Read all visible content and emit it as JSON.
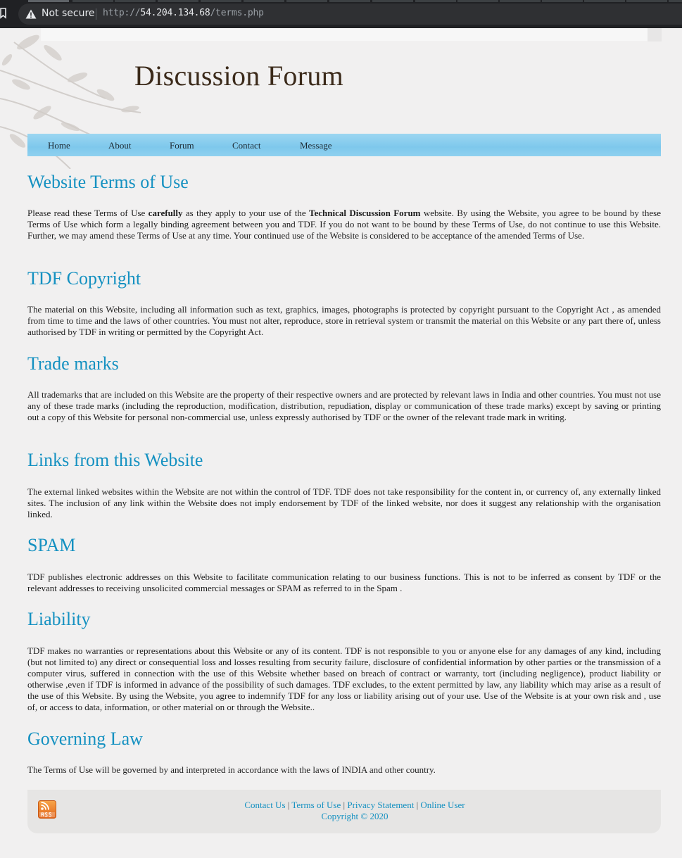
{
  "browser": {
    "security_label": "Not secure",
    "url_scheme": "http://",
    "url_host": "54.204.134.68",
    "url_path": "/terms.php"
  },
  "site": {
    "title": "Discussion Forum"
  },
  "nav": {
    "items": [
      {
        "label": "Home"
      },
      {
        "label": "About"
      },
      {
        "label": "Forum"
      },
      {
        "label": "Contact"
      },
      {
        "label": "Message"
      }
    ]
  },
  "sections": [
    {
      "heading": "Website Terms of Use",
      "body_parts": [
        "Please read these Terms of Use ",
        "carefully",
        " as they apply to your use of the ",
        "Technical Discussion Forum",
        " website. By using the Website, you agree to be bound by these Terms of Use which form a legally binding agreement between you and TDF. If you do not want to be bound by these Terms of Use, do not continue to use this Website. Further, we may amend these Terms of Use at any time. Your continued use of the Website is considered to be acceptance of the amended Terms of Use."
      ]
    },
    {
      "heading": "TDF Copyright",
      "body": "The material on this Website, including all information such as text, graphics, images, photographs is protected by copyright pursuant to the Copyright Act , as amended from time to time and the laws of other countries. You must not alter, reproduce, store in retrieval system or transmit the material on this Website or any part there of, unless authorised by TDF in writing or permitted by the Copyright Act."
    },
    {
      "heading": "Trade marks",
      "body": "All trademarks that are included on this Website are the property of their respective owners and are protected by relevant laws in India and other countries. You must not use any of these trade marks (including the reproduction, modification, distribution, repudiation, display or communication of these trade marks) except by saving or printing out a copy of this Website for personal non-commercial use, unless expressly authorised by TDF or the owner of the relevant trade mark in writing."
    },
    {
      "heading": "Links from this Website",
      "body": "The external linked websites within the Website are not within the control of TDF. TDF does not take responsibility for the content in, or currency of, any externally linked sites. The inclusion of any link within the Website does not imply endorsement by TDF of the linked website, nor does it suggest any relationship with the organisation linked."
    },
    {
      "heading": "SPAM",
      "body": "TDF publishes electronic addresses on this Website to facilitate communication relating to our business functions. This is not to be inferred as consent by TDF or the relevant addresses to receiving unsolicited commercial messages or SPAM as referred to in the Spam ."
    },
    {
      "heading": "Liability",
      "body": "TDF makes no warranties or representations about this Website or any of its content. TDF is not responsible to you or anyone else for any damages of any kind, including (but not limited to) any direct or consequential loss and losses resulting from security failure, disclosure of confidential information by other parties or the transmission of a computer virus, suffered in connection with the use of this Website whether based on breach of contract or warranty, tort (including negligence), product liability or otherwise ,even if TDF is informed in advance of the possibility of such damages. TDF excludes, to the extent permitted by law, any liability which may arise as a result of the use of this Website. By using the Website, you agree to indemnify TDF for any loss or liability arising out of your use. Use of the Website is at your own risk and , use of, or access to data, information, or other material on or through the Website.."
    },
    {
      "heading": "Governing Law",
      "body": "The Terms of Use will be governed by and interpreted in accordance with the laws of INDIA and other country."
    }
  ],
  "footer": {
    "links": [
      "Contact Us",
      "Terms of Use",
      "Privacy Statement",
      "Online User"
    ],
    "separator": "|",
    "copyright": "Copyright © 2020",
    "rss_icon": "rss-icon"
  },
  "colors": {
    "heading": "#1591c1",
    "nav_bar": "#8fd0ef",
    "title": "#3b2a1a"
  }
}
